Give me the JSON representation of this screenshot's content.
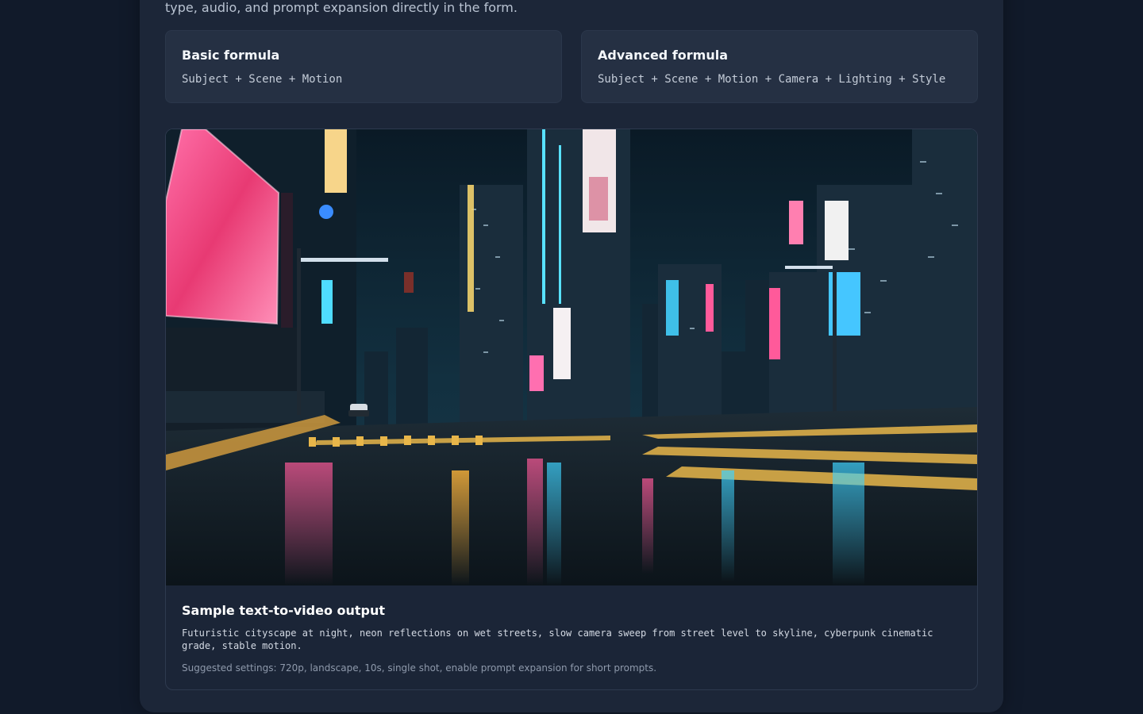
{
  "intro": {
    "text": "type, audio, and prompt expansion directly in the form."
  },
  "formulas": {
    "basic": {
      "title": "Basic formula",
      "text": "Subject + Scene + Motion"
    },
    "advanced": {
      "title": "Advanced formula",
      "text": "Subject + Scene + Motion + Camera + Lighting + Style"
    }
  },
  "sample": {
    "title": "Sample text-to-video output",
    "prompt": "Futuristic cityscape at night, neon reflections on wet streets, slow camera sweep from street level to skyline, cyberpunk cinematic grade, stable motion.",
    "settings": "Suggested settings: 720p, landscape, 10s, single shot, enable prompt expansion for short prompts."
  },
  "colors": {
    "page_background": "#111a2a",
    "panel_background": "#1c2638",
    "card_background": "#253043",
    "neon_pink": "#ff4f8f",
    "neon_cyan": "#38d6ff",
    "road_yellow": "#e8b64a"
  }
}
